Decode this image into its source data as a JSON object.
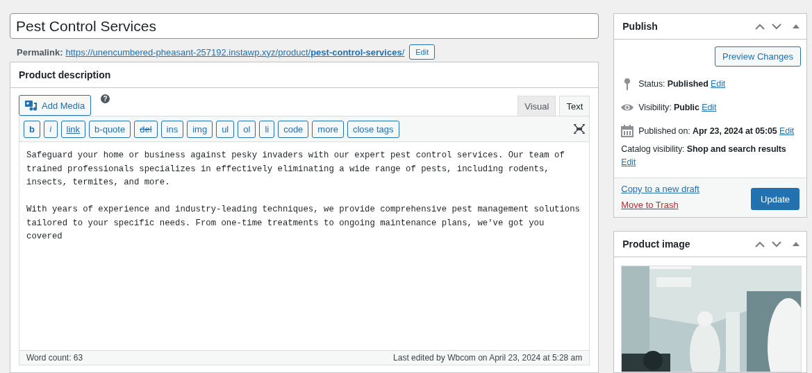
{
  "post_title": {
    "value": "Pest Control Services"
  },
  "permalink": {
    "label": "Permalink:",
    "url_base": "https://unencumbered-pheasant-257192.instawp.xyz/product/",
    "slug": "pest-control-services",
    "trail": "/",
    "edit": "Edit"
  },
  "description": {
    "title": "Product description",
    "add_media": "Add Media",
    "help": "?",
    "tabs": [
      {
        "label": "Visual",
        "selected": false
      },
      {
        "label": "Text",
        "selected": true
      }
    ],
    "quicktags": [
      {
        "label": "b",
        "kind": "bold"
      },
      {
        "label": "i",
        "kind": "italic"
      },
      {
        "label": "link",
        "kind": "underline"
      },
      {
        "label": "b-quote",
        "kind": "plain"
      },
      {
        "label": "del",
        "kind": "strike"
      },
      {
        "label": "ins",
        "kind": "plain"
      },
      {
        "label": "img",
        "kind": "plain"
      },
      {
        "label": "ul",
        "kind": "plain"
      },
      {
        "label": "ol",
        "kind": "plain"
      },
      {
        "label": "li",
        "kind": "plain"
      },
      {
        "label": "code",
        "kind": "plain"
      },
      {
        "label": "more",
        "kind": "plain"
      },
      {
        "label": "close tags",
        "kind": "plain"
      }
    ],
    "paragraphs": [
      "Safeguard your home or business against pesky invaders with our expert pest control services. Our team of trained professionals specializes in effectively eliminating a wide range of pests, including rodents, insects, termites, and more.",
      "With years of experience and industry-leading techniques, we provide comprehensive pest management solutions tailored to your specific needs. From one-time treatments to ongoing maintenance plans, we've got you covered"
    ],
    "word_count": "Word count: 63",
    "last_edited": "Last edited by Wbcom on April 23, 2024 at 5:28 am"
  },
  "publish": {
    "title": "Publish",
    "preview": "Preview Changes",
    "rows": [
      {
        "kind": "pin",
        "text": "Status: **Published**",
        "edit": "Edit"
      },
      {
        "kind": "eye",
        "text": "Visibility: **Public**",
        "edit": "Edit"
      },
      {
        "kind": "calendar",
        "text": "Published on: **Apr 23, 2024 at 05:05**",
        "edit": "Edit"
      },
      {
        "kind": "plain",
        "text": "Catalog visibility: **Shop and search results**",
        "edit": "Edit"
      }
    ],
    "copy_draft": "Copy to a new draft",
    "trash": "Move to Trash",
    "update": "Update"
  },
  "product_image": {
    "title": "Product image",
    "kind": "picture"
  }
}
